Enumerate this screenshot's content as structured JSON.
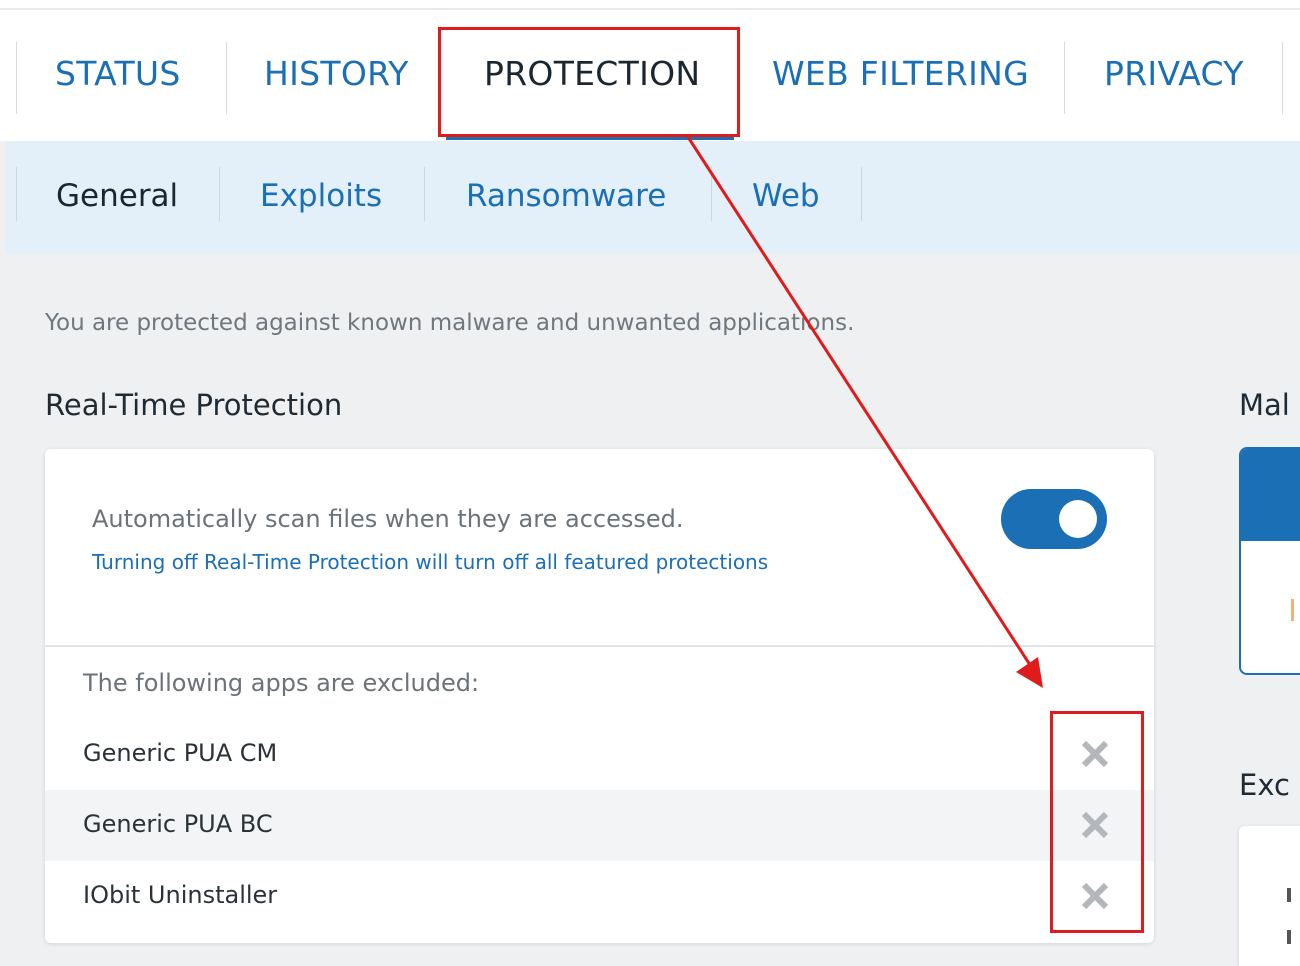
{
  "main_tabs": [
    {
      "label": "STATUS"
    },
    {
      "label": "HISTORY"
    },
    {
      "label": "PROTECTION",
      "active": true
    },
    {
      "label": "WEB FILTERING"
    },
    {
      "label": "PRIVACY"
    }
  ],
  "sub_tabs": [
    {
      "label": "General",
      "active": true
    },
    {
      "label": "Exploits"
    },
    {
      "label": "Ransomware"
    },
    {
      "label": "Web"
    }
  ],
  "status_message": "You are protected against known malware and unwanted applications.",
  "real_time": {
    "title": "Real-Time Protection",
    "description": "Automatically scan files when they are accessed.",
    "warning": "Turning off Real-Time Protection will turn off all featured protections",
    "toggle_on": true
  },
  "exclusions": {
    "label": "The following apps are excluded:",
    "items": [
      {
        "name": "Generic PUA CM"
      },
      {
        "name": "Generic PUA BC"
      },
      {
        "name": "IObit Uninstaller"
      }
    ]
  },
  "side_sections": {
    "title_1": "Mal",
    "title_2": "Exc"
  },
  "colors": {
    "accent": "#1a6fb5",
    "annotation": "#e01b1b"
  },
  "icons": {
    "remove": "close-icon",
    "toggle": "toggle-switch"
  }
}
